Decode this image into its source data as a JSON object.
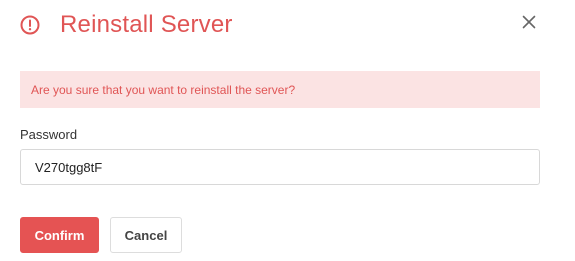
{
  "dialog": {
    "title": "Reinstall Server",
    "title_icon": "alert-circle-icon",
    "close_icon": "close-icon"
  },
  "warning": {
    "message": "Are you sure that you want to reinstall the server?"
  },
  "password_field": {
    "label": "Password",
    "value": "V270tgg8tF"
  },
  "actions": {
    "confirm_label": "Confirm",
    "cancel_label": "Cancel"
  },
  "colors": {
    "accent": "#e05555",
    "warning_bg": "#fbe3e3",
    "confirm_bg": "#e55353"
  }
}
